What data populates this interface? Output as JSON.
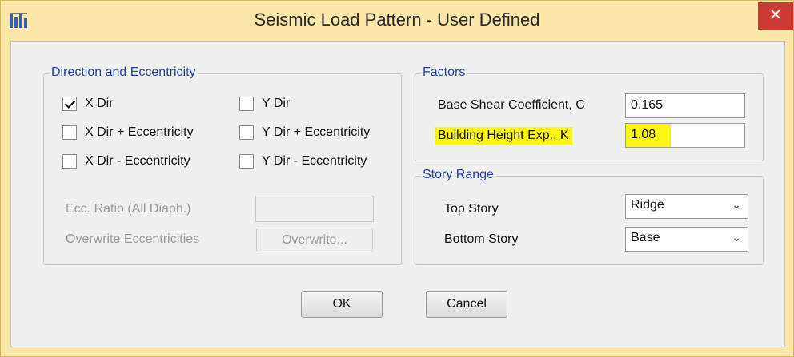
{
  "window": {
    "title": "Seismic Load Pattern - User Defined",
    "close_glyph": "✕",
    "app_icon": "etabs-app-icon"
  },
  "direction_group": {
    "label": "Direction and Eccentricity",
    "checkboxes": [
      {
        "label": "X Dir",
        "checked": true
      },
      {
        "label": "X Dir + Eccentricity",
        "checked": false
      },
      {
        "label": "X Dir - Eccentricity",
        "checked": false
      },
      {
        "label": "Y Dir",
        "checked": false
      },
      {
        "label": "Y Dir + Eccentricity",
        "checked": false
      },
      {
        "label": "Y Dir - Eccentricity",
        "checked": false
      }
    ],
    "ecc_ratio_label": "Ecc. Ratio (All Diaph.)",
    "ecc_ratio_value": "",
    "overwrite_label": "Overwrite Eccentricities",
    "overwrite_button": "Overwrite..."
  },
  "factors_group": {
    "label": "Factors",
    "base_shear_label": "Base Shear Coefficient, C",
    "base_shear_value": "0.165",
    "height_exp_label": "Building Height Exp., K",
    "height_exp_value": "1.08",
    "highlight_color": "#fcf50f"
  },
  "story_group": {
    "label": "Story Range",
    "top_label": "Top Story",
    "top_value": "Ridge",
    "bottom_label": "Bottom Story",
    "bottom_value": "Base"
  },
  "buttons": {
    "ok": "OK",
    "cancel": "Cancel"
  }
}
